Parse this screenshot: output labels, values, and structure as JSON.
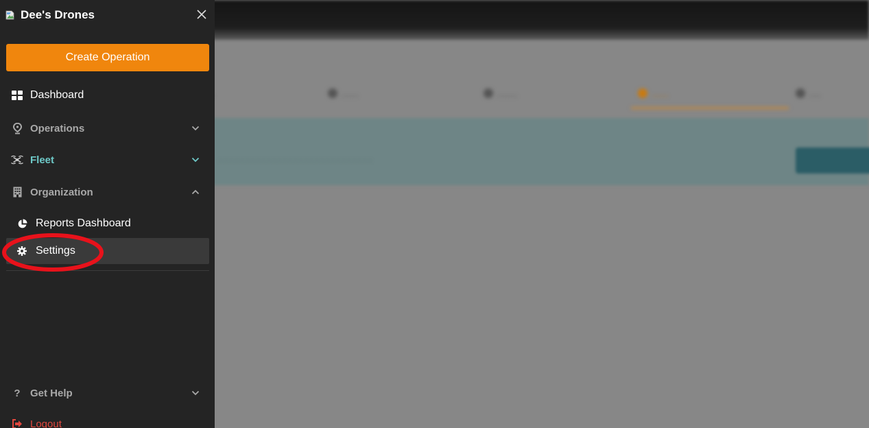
{
  "app": {
    "brand_name": "Dee's Drones",
    "brand_logo_icon": "broken-image-icon"
  },
  "drawer": {
    "close_icon": "close-icon",
    "create_operation_label": "Create Operation",
    "nav": [
      {
        "label": "Dashboard",
        "icon": "dashboard-grid-icon"
      },
      {
        "label": "Operations",
        "icon": "map-pin-icon",
        "chevron": "down"
      },
      {
        "label": "Fleet",
        "icon": "drone-icon",
        "chevron": "down"
      },
      {
        "label": "Organization",
        "icon": "building-icon",
        "chevron": "up"
      }
    ],
    "organization_items": [
      {
        "label": "Reports Dashboard",
        "icon": "pie-chart-icon"
      },
      {
        "label": "Settings",
        "icon": "gear-icon",
        "active": true
      }
    ],
    "help": {
      "label": "Get Help",
      "icon": "question-icon",
      "icon_glyph": "?",
      "chevron": "down"
    },
    "logout": {
      "label": "Logout",
      "icon": "logout-icon"
    }
  },
  "colors": {
    "accent_orange": "#f0860d",
    "fleet_teal": "#6ec9c8",
    "logout_red": "#e0473e",
    "annotation_red": "#e8121b",
    "drawer_bg": "#242424"
  }
}
